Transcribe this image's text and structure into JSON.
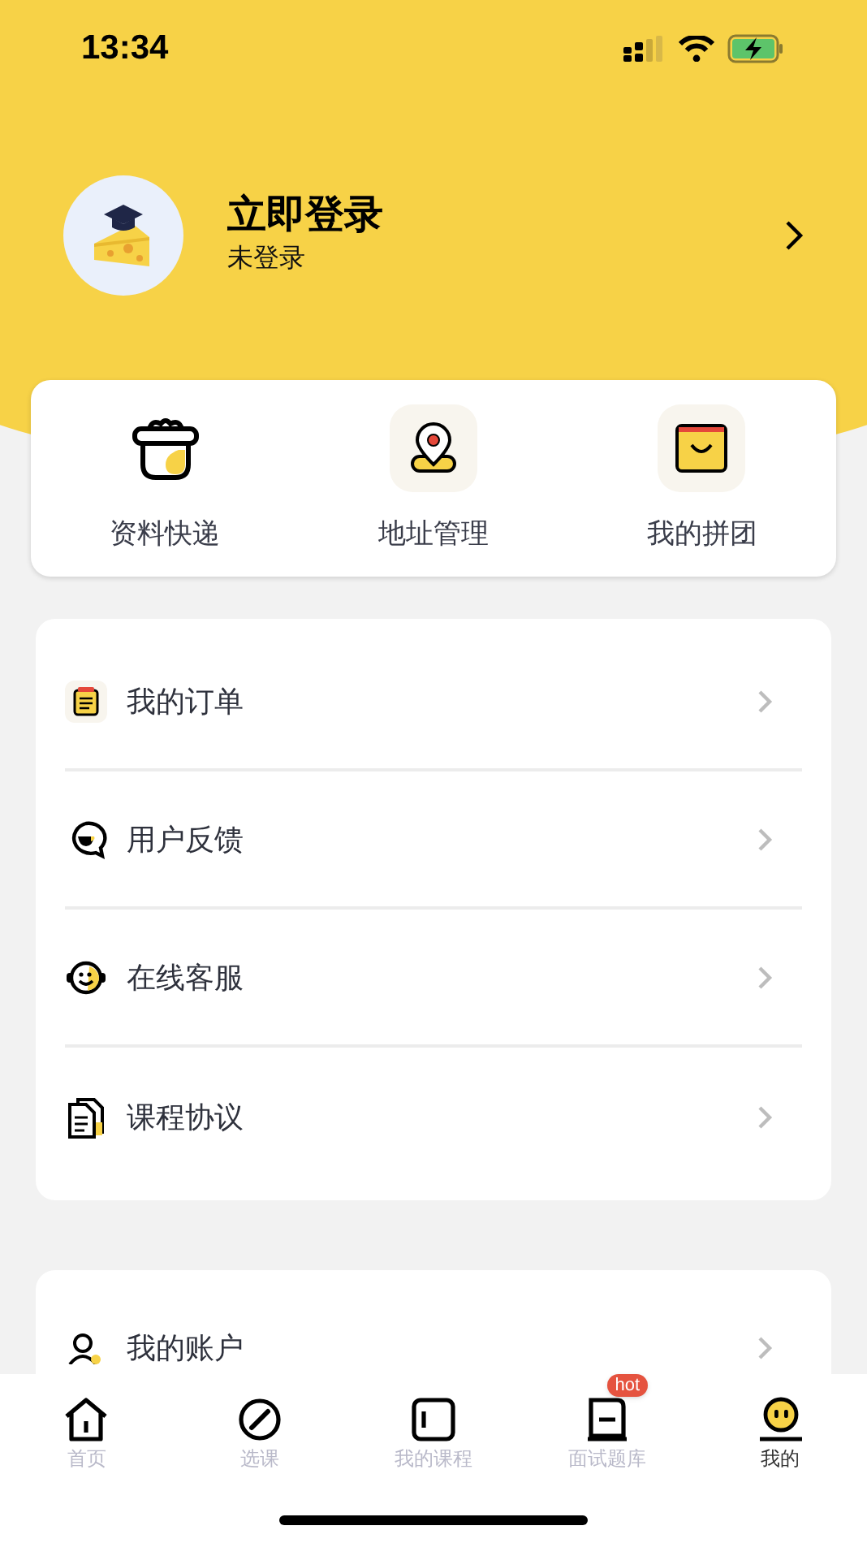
{
  "status_bar": {
    "time": "13:34"
  },
  "profile": {
    "title": "立即登录",
    "subtitle": "未登录"
  },
  "quick_actions": [
    {
      "kind": "gift",
      "label": "资料快递"
    },
    {
      "kind": "location",
      "label": "地址管理"
    },
    {
      "kind": "bag",
      "label": "我的拼团"
    }
  ],
  "menu": [
    {
      "kind": "order",
      "label": "我的订单"
    },
    {
      "kind": "feedback",
      "label": "用户反馈"
    },
    {
      "kind": "service",
      "label": "在线客服"
    },
    {
      "kind": "agreement",
      "label": "课程协议"
    }
  ],
  "menu_2": [
    {
      "kind": "account",
      "label": "我的账户"
    }
  ],
  "tab_bar": [
    {
      "kind": "home",
      "label": "首页",
      "selected": false
    },
    {
      "kind": "compass",
      "label": "选课",
      "selected": false
    },
    {
      "kind": "course",
      "label": "我的课程",
      "selected": false
    },
    {
      "kind": "questions",
      "label": "面试题库",
      "selected": false,
      "badge": "hot"
    },
    {
      "kind": "me",
      "label": "我的",
      "selected": true
    }
  ]
}
